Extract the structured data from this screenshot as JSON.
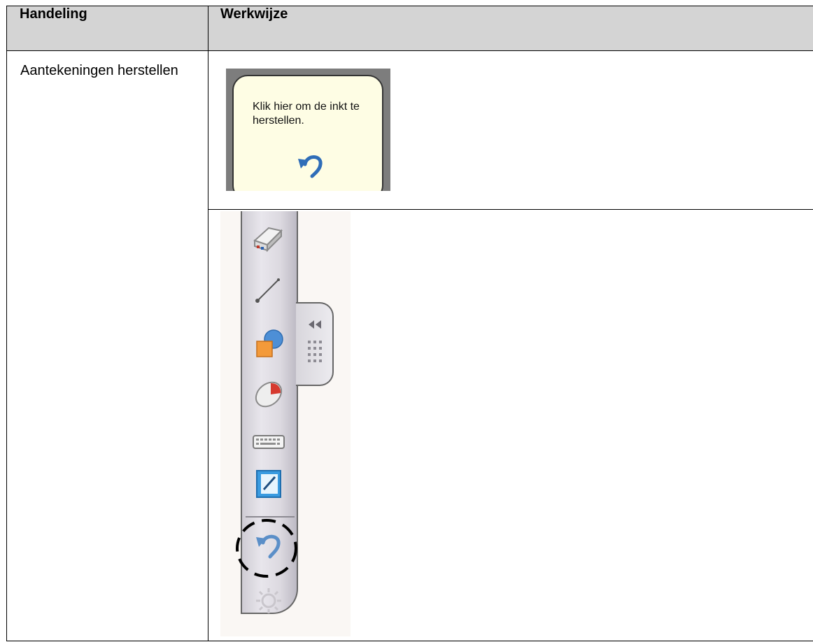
{
  "table": {
    "headers": [
      "Handeling",
      "Werkwijze"
    ],
    "rows": [
      {
        "action": "Aantekeningen herstellen"
      }
    ]
  },
  "tooltip": {
    "text": "Klik hier om de inkt te herstellen.",
    "icon": "undo-arrow-icon",
    "colors": {
      "bubble": "#fefde4",
      "frame": "#7d7d7d"
    }
  },
  "toolbar": {
    "tools": [
      {
        "name": "eraser-icon"
      },
      {
        "name": "line-icon"
      },
      {
        "name": "shapes-icon"
      },
      {
        "name": "mouse-icon"
      },
      {
        "name": "keyboard-icon"
      },
      {
        "name": "notebook-icon"
      },
      {
        "name": "undo-icon",
        "highlighted": true
      },
      {
        "name": "settings-icon"
      }
    ],
    "tab_icons": [
      "collapse-arrows-icon",
      "grip-dots-icon"
    ]
  }
}
